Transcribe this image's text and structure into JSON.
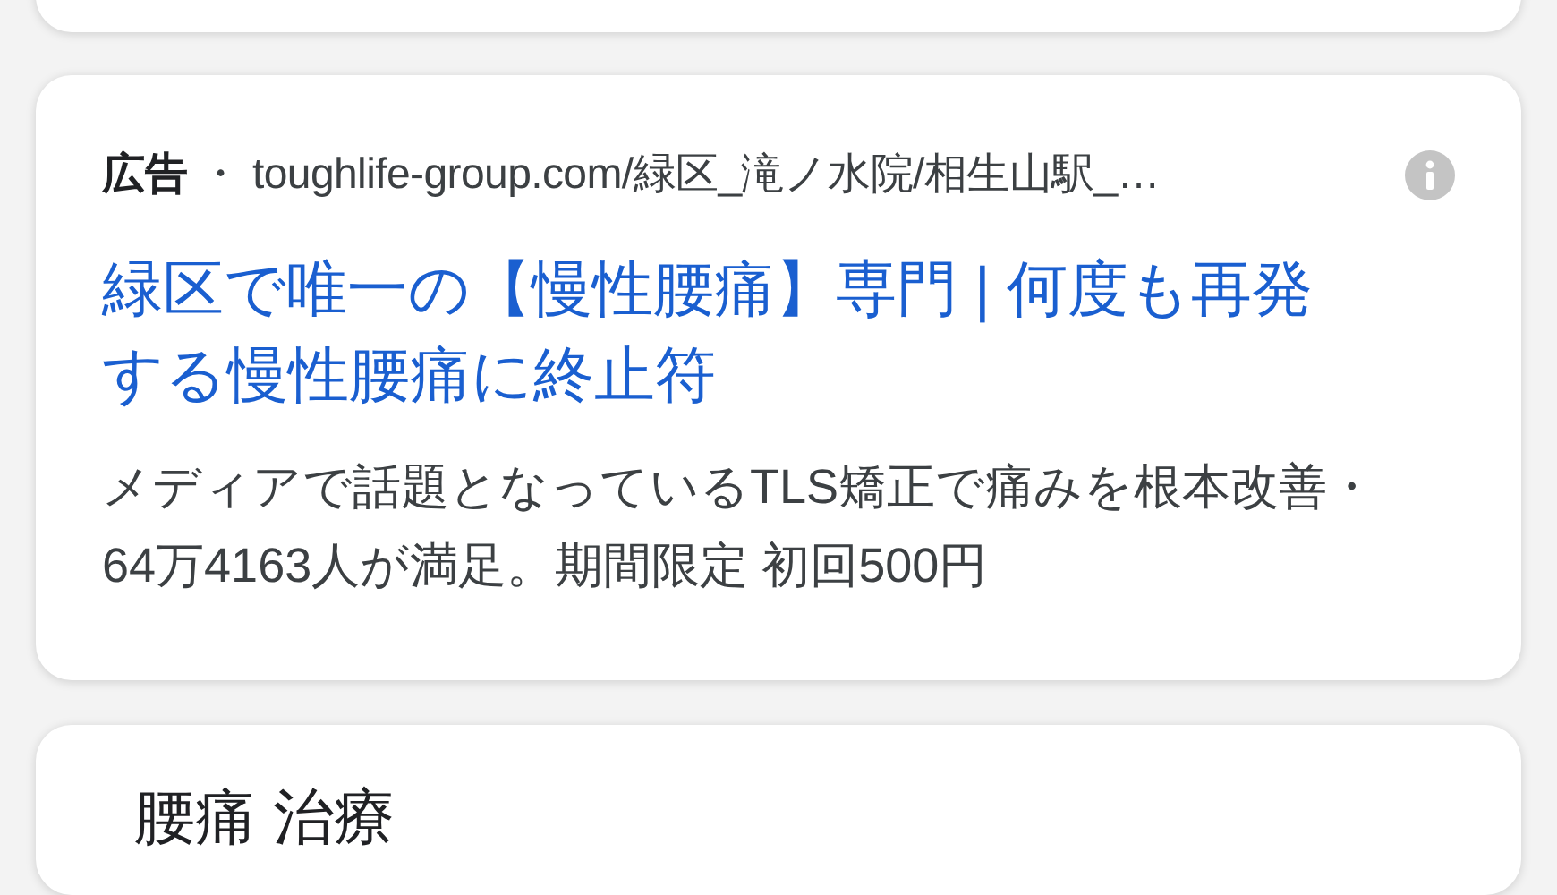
{
  "ad": {
    "label": "広告",
    "separator": "・",
    "url": "toughlife-group.com/緑区_滝ノ水院/相生山駅_…",
    "title": "緑区で唯一の【慢性腰痛】専門 | 何度も再発する慢性腰痛に終止符",
    "description": "メディアで話題となっているTLS矯正で痛みを根本改善・64万4163人が満足。期間限定 初回500円"
  },
  "next_card": {
    "title": "腰痛 治療"
  }
}
